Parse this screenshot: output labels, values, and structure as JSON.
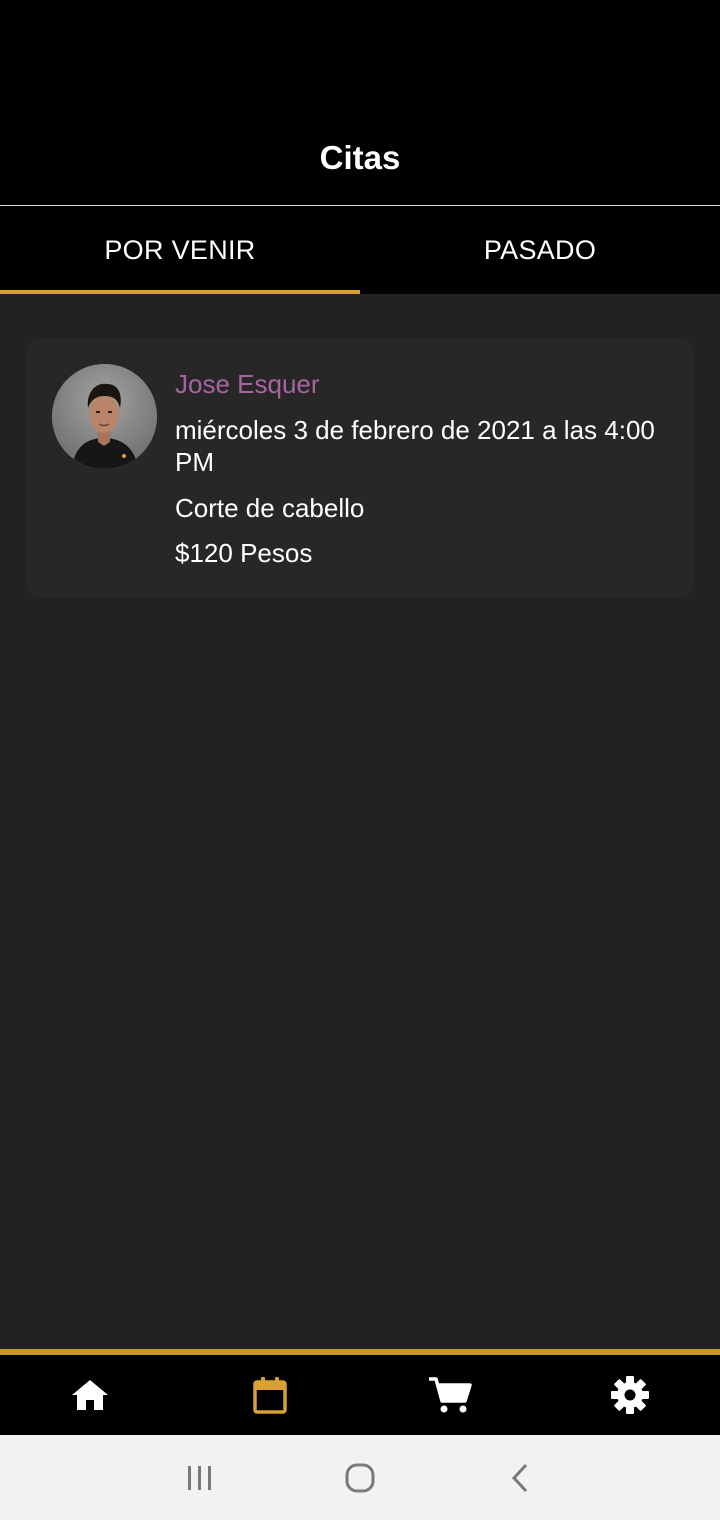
{
  "header": {
    "title": "Citas"
  },
  "tabs": [
    {
      "label": "POR VENIR",
      "active": true
    },
    {
      "label": "PASADO",
      "active": false
    }
  ],
  "appointments": [
    {
      "barber": "Jose Esquer",
      "date": "miércoles 3 de febrero de 2021 a las 4:00 PM",
      "service": "Corte de cabello",
      "price": "$120 Pesos"
    }
  ],
  "bottom_nav": [
    {
      "icon": "home-icon",
      "active": false
    },
    {
      "icon": "calendar-icon",
      "active": true
    },
    {
      "icon": "cart-icon",
      "active": false
    },
    {
      "icon": "gear-icon",
      "active": false
    }
  ],
  "system_nav": [
    "recents-icon",
    "home-circle-icon",
    "back-icon"
  ],
  "colors": {
    "background": "#222222",
    "bar": "#000000",
    "accent": "#d9a032",
    "name": "#a864a0",
    "card": "#272727"
  }
}
